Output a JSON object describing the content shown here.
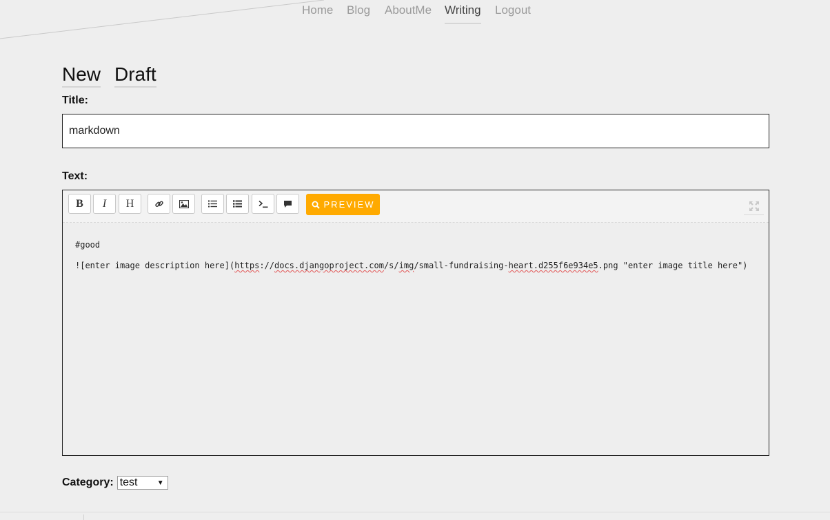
{
  "nav": {
    "items": [
      {
        "label": "Home",
        "active": false
      },
      {
        "label": "Blog",
        "active": false
      },
      {
        "label": "AboutMe",
        "active": false
      },
      {
        "label": "Writing",
        "active": true
      },
      {
        "label": "Logout",
        "active": false
      }
    ]
  },
  "heading": {
    "tabs": [
      "New",
      "Draft"
    ]
  },
  "form": {
    "title_label": "Title:",
    "title_value": "markdown",
    "text_label": "Text:",
    "category_label": "Category:",
    "category_selected": "test"
  },
  "editor": {
    "toolbar": {
      "bold_label": "B",
      "italic_label": "I",
      "heading_label": "H",
      "preview_label": "PREVIEW",
      "icons": [
        "bold-icon",
        "italic-icon",
        "heading-icon",
        "link-icon",
        "image-icon",
        "unordered-list-icon",
        "ordered-list-icon",
        "code-icon",
        "quote-icon",
        "search-icon",
        "fullscreen-icon"
      ]
    },
    "content": {
      "line1": "#good",
      "line2_start": "![enter image description here](",
      "url_https": "https",
      "url_sep1": "://",
      "url_domain": "docs.djangoproject.com",
      "url_sep2": "/s/",
      "url_img": "img",
      "url_sep3": "/small-fundraising-",
      "url_heart": "heart.d255f6e934e5",
      "url_ext": ".png",
      "line2_end": " \"enter image title here\")"
    }
  },
  "colors": {
    "accent": "#ffaa00",
    "background": "#eeeeee",
    "nav_inactive": "#9a9a9a",
    "nav_active": "#444444"
  }
}
